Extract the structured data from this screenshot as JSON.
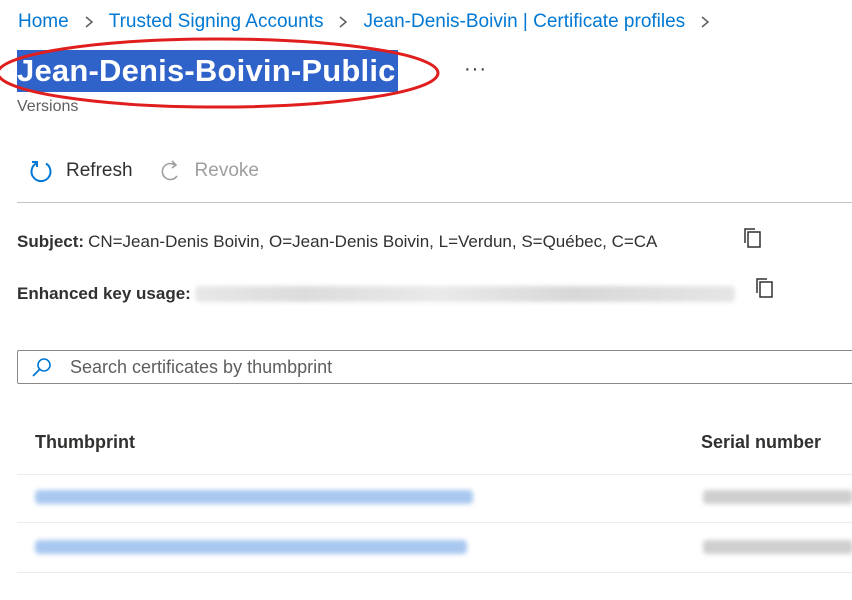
{
  "breadcrumb": {
    "items": [
      {
        "label": "Home"
      },
      {
        "label": "Trusted Signing Accounts"
      },
      {
        "label": "Jean-Denis-Boivin | Certificate profiles"
      }
    ]
  },
  "page": {
    "title": "Jean-Denis-Boivin-Public",
    "subtitle": "Versions",
    "more_label": "···"
  },
  "toolbar": {
    "refresh_label": "Refresh",
    "revoke_label": "Revoke"
  },
  "details": {
    "subject_label": "Subject:",
    "subject_value": "CN=Jean-Denis Boivin, O=Jean-Denis Boivin, L=Verdun, S=Québec, C=CA",
    "eku_label": "Enhanced key usage:"
  },
  "search": {
    "placeholder": "Search certificates by thumbprint",
    "value": ""
  },
  "table": {
    "columns": [
      "Thumbprint",
      "Serial number"
    ]
  },
  "colors": {
    "accent": "#0078d4",
    "title_highlight": "#3063c9",
    "annotation_ellipse": "#e01e1e"
  }
}
